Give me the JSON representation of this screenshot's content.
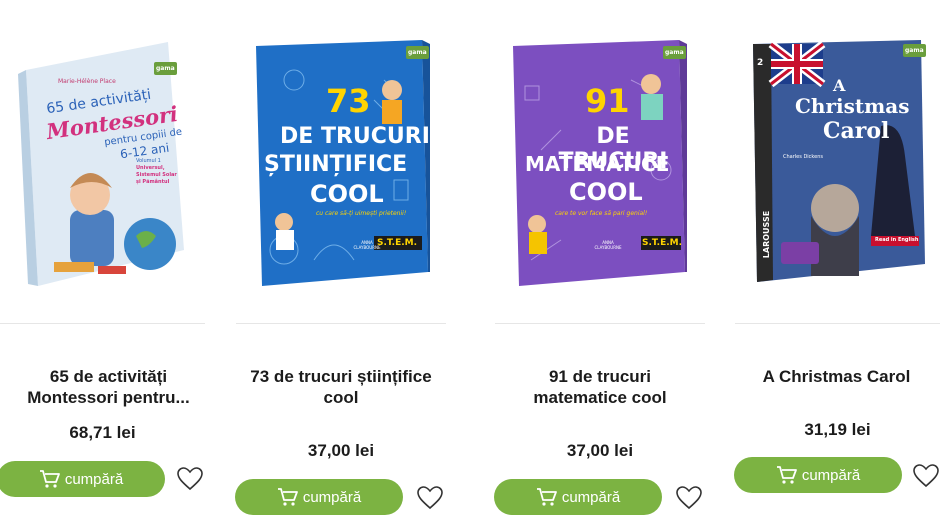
{
  "products": [
    {
      "cover": {
        "publisher": "gama",
        "author": "Marie-Hélène Place",
        "l1": "65 de activități",
        "l2": "Montessori",
        "l3": "pentru copiii de",
        "l4": "6-12 ani",
        "l5": "Volumul 1",
        "l6": "Universul,",
        "l7": "Sistemul Solar",
        "l8": "și Pământul"
      },
      "title": "65 de activități Montessori pentru...",
      "price": "68,71 lei",
      "buy_label": "cumpără"
    },
    {
      "cover": {
        "publisher": "gama",
        "big": "73",
        "l1": "DE TRUCURI",
        "l2": "ȘTIINȚIFICE",
        "l3": "COOL",
        "sub": "cu care să-ți uimești prietenii!",
        "author": "ANNA CLAYBOURNE",
        "badge": "S.T.E.M."
      },
      "title": "73 de trucuri științifice cool",
      "price": "37,00 lei",
      "buy_label": "cumpără"
    },
    {
      "cover": {
        "publisher": "gama",
        "big": "91",
        "l1": "DE TRUCURI",
        "l2": "MATEMATICE",
        "l3": "COOL",
        "sub": "care te vor face să pari genial!",
        "author": "ANNA CLAYBOURNE",
        "badge": "S.T.E.M."
      },
      "title": "91 de trucuri matematice cool",
      "price": "37,00 lei",
      "buy_label": "cumpără"
    },
    {
      "cover": {
        "publisher": "gama",
        "num": "2",
        "l1": "A",
        "l2": "Christmas",
        "l3": "Carol",
        "author_pre": "Charles Dickens",
        "spine": "LAROUSSE",
        "tag": "Read in English"
      },
      "title": "A Christmas Carol",
      "price": "31,19 lei",
      "buy_label": "cumpără"
    }
  ],
  "colors": {
    "button": "#7cb342",
    "cover1": "#dbe9f4",
    "cover2": "#1f6fc6",
    "cover3": "#7c4fc0",
    "cover4": "#33508a"
  }
}
